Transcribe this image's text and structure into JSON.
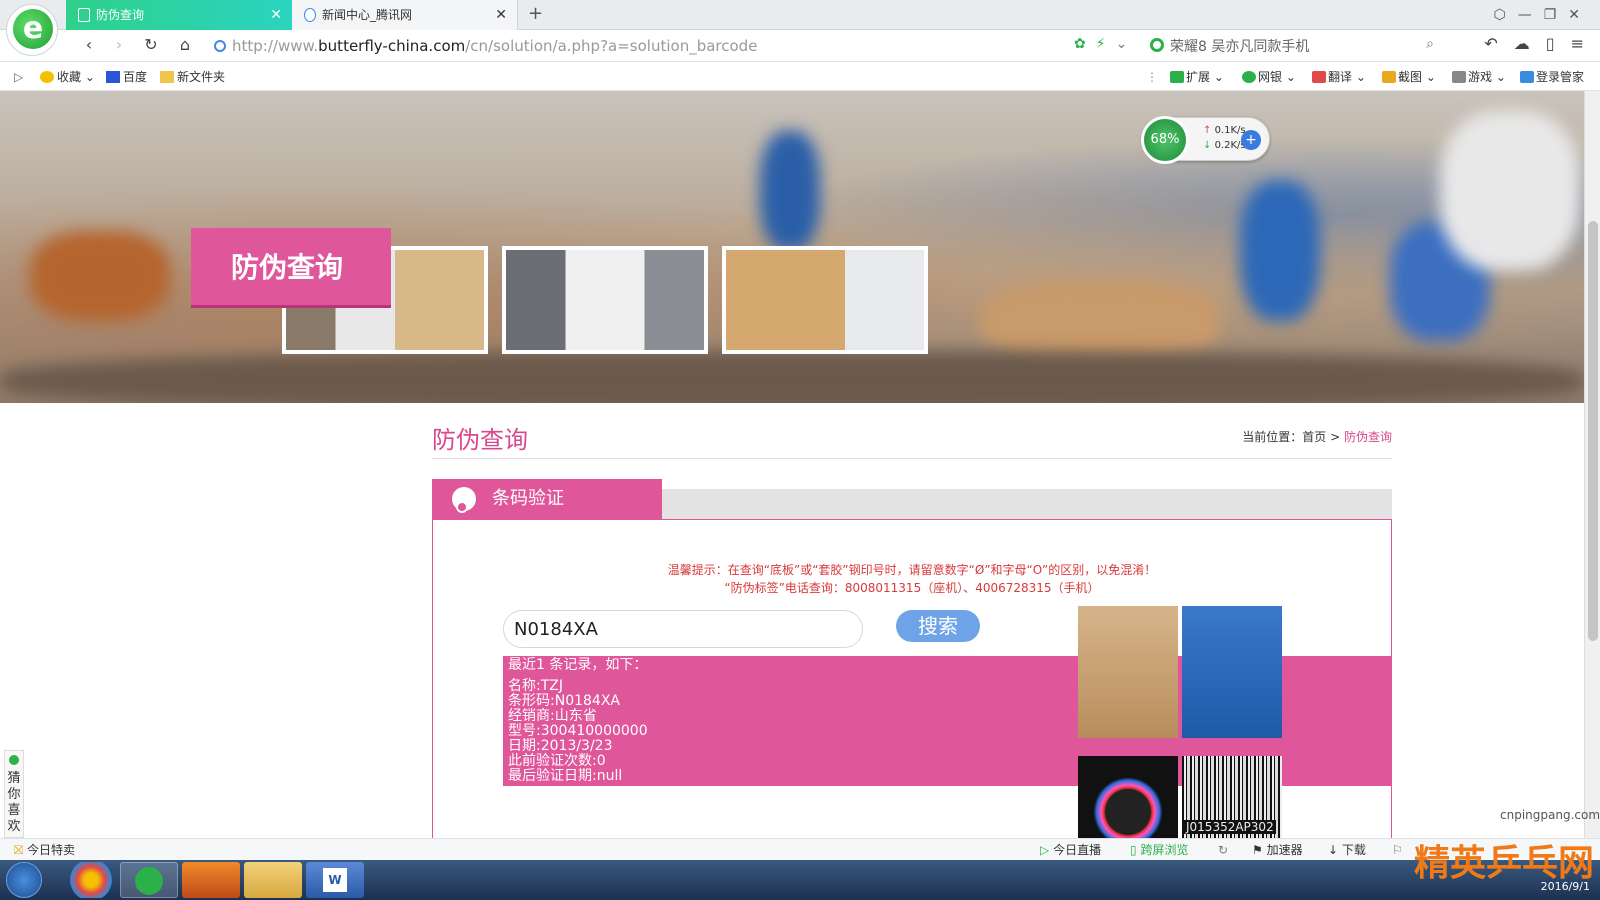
{
  "browser": {
    "tabs": [
      {
        "label": "防伪查询",
        "active": true
      },
      {
        "label": "新闻中心_腾讯网",
        "active": false
      }
    ],
    "url_prefix": "http://www.",
    "url_domain": "butterfly-china.com",
    "url_path": "/cn/solution/a.php?a=solution_barcode",
    "search_value": "荣耀8 吴亦凡同款手机",
    "bookmarks": [
      "收藏",
      "百度",
      "新文件夹"
    ],
    "extensions": [
      "扩展",
      "网银",
      "翻译",
      "截图",
      "游戏",
      "登录管家"
    ]
  },
  "speed_widget": {
    "percent": "68%",
    "up": "0.1K/s",
    "down": "0.2K/s"
  },
  "hero": {
    "title": "防伪查询"
  },
  "content": {
    "title": "防伪查询",
    "breadcrumb_label": "当前位置：首页 >",
    "breadcrumb_current": "防伪查询",
    "panel_tab": "条码验证",
    "tip_line1": "温馨提示：在查询“底板”或“套胶”钢印号时，请留意数字“Ø”和字母“O”的区别，以免混淆！",
    "tip_line2": "“防伪标签”电话查询：8008011315（座机）、4006728315（手机）",
    "barcode_value": "N0184XA",
    "search_button": "搜索",
    "result": {
      "header": "最近1 条记录，如下：",
      "lines": [
        "名称:TZJ",
        "条形码:N0184XA",
        "经销商:山东省",
        "型号:300410000000",
        "日期:2013/3/23",
        "此前验证次数:0",
        "最后验证日期:null"
      ]
    },
    "sample_label": "J015352AP302"
  },
  "side": {
    "guess": "猜你喜欢"
  },
  "statusbar": {
    "left": "今日特卖",
    "items": [
      "今日直播",
      "跨屏浏览",
      "加速器",
      "下载"
    ]
  },
  "taskbar": {
    "date": "2016/9/1"
  },
  "watermark": {
    "text": "精英乒乓网",
    "domain": "cnpingpang.com"
  },
  "colors": {
    "accent": "#e0569a",
    "tip": "#d93a3a",
    "button": "#6fa3e8"
  }
}
